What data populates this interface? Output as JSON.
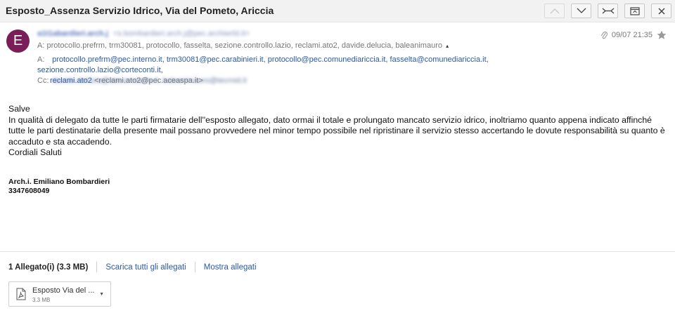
{
  "header": {
    "subject": "Esposto_Assenza Servizio Idrico, Via del Pometo, Ariccia",
    "buttons": {
      "prev": "chevron-up-icon",
      "next": "chevron-down-icon",
      "collapse": "collapse-arrows-icon",
      "popout": "popout-window-icon",
      "close": "close-icon"
    }
  },
  "message": {
    "avatar_letter": "E",
    "avatar_color": "#7a1e5a",
    "sender_name": "a1t1abardieri.arch.j",
    "sender_addr": "<s.bombardieri.arch.j@pec.archiwrld.it>",
    "to_summary_label": "A:",
    "to_summary": "protocollo.prefrm, trm30081, protocollo, fasselta, sezione.controllo.lazio, reclami.ato2, davide.delucia, baleanimauro",
    "to_summary_toggle": "▴",
    "to_label": "A:",
    "recipients": [
      "protocollo.prefrm@pec.interno.it,",
      "trm30081@pec.carabinieri.it,",
      "protocollo@pec.comunediariccia.it,",
      "fasselta@comunediariccia.it,",
      "sezione.controllo.lazio@corteconti.it,"
    ],
    "recipient_last_name": "reclami.ato2",
    "recipient_last_addr": "<reclami.ato2@pec.aceaspa.it>",
    "cc_label": "Cc:",
    "cc_value": "davide.delucia@ateconsitelia.it, baleanimauro@tecrnid.it",
    "date": "09/07 21:35",
    "attachment_icon": "paperclip-icon",
    "star_icon": "star-icon",
    "star_color": "#9a9a9a"
  },
  "body": {
    "greeting": "Salve",
    "paragraph": "In qualità di delegato da tutte le parti firmatarie dell''esposto allegato, dato ormai il  totale e prolungato mancato servizio idrico, inoltriamo quanto appena indicato affinché tutte le parti destinatarie della presente mail possano provvedere nel minor tempo possibile nel ripristinare il servizio stesso  accertando le dovute responsabilità su quanto è accaduto e sta accadendo.",
    "closing": "Cordiali Saluti",
    "signature_name": "Arch.i. Emiliano Bombardieri",
    "signature_phone": "3347608049"
  },
  "attachments": {
    "count_label": "1 Allegato(i) (3.3 MB)",
    "download_all": "Scarica tutti gli allegati",
    "show": "Mostra allegati",
    "files": [
      {
        "name": "Esposto Via del ...",
        "size": "3.3 MB",
        "icon": "pdf-icon"
      }
    ]
  }
}
